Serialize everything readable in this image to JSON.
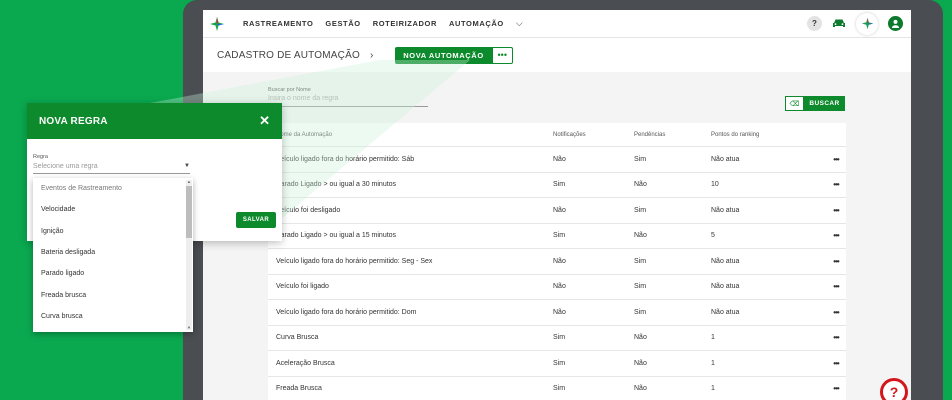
{
  "topbar": {
    "nav": [
      "RASTREAMENTO",
      "GESTÃO",
      "ROTEIRIZADOR",
      "AUTOMAÇÃO"
    ],
    "help_label": "?",
    "user_label": "●"
  },
  "titlebar": {
    "title": "CADASTRO DE AUTOMAÇÃO",
    "chevron": "›",
    "new_button": "NOVA AUTOMAÇÃO",
    "more_button": "•••"
  },
  "search": {
    "label": "Buscar por Nome",
    "placeholder": "Insira o nome da regra",
    "button": "BUSCAR"
  },
  "table": {
    "headers": [
      "Nome da Automação",
      "Notificações",
      "Pendências",
      "Pontos do ranking"
    ],
    "rows": [
      [
        "Veículo ligado fora do horário permitido: Sáb",
        "Não",
        "Sim",
        "Não atua"
      ],
      [
        "Parado Ligado > ou igual a 30 minutos",
        "Sim",
        "Não",
        "10"
      ],
      [
        "Veículo foi desligado",
        "Não",
        "Sim",
        "Não atua"
      ],
      [
        "Parado Ligado > ou igual a 15 minutos",
        "Sim",
        "Não",
        "5"
      ],
      [
        "Veículo ligado fora do horário permitido: Seg - Sex",
        "Não",
        "Sim",
        "Não atua"
      ],
      [
        "Veículo foi ligado",
        "Não",
        "Sim",
        "Não atua"
      ],
      [
        "Veículo ligado fora do horário permitido: Dom",
        "Não",
        "Sim",
        "Não atua"
      ],
      [
        "Curva Brusca",
        "Sim",
        "Não",
        "1"
      ],
      [
        "Aceleração Brusca",
        "Sim",
        "Não",
        "1"
      ],
      [
        "Freada Brusca",
        "Sim",
        "Não",
        "1"
      ]
    ],
    "row_action": "•••"
  },
  "help_float": "?",
  "modal": {
    "title": "NOVA REGRA",
    "close": "✕",
    "field_label": "Regra",
    "field_placeholder": "Selecione uma regra",
    "save_button": "SALVAR"
  },
  "dropdown": {
    "items": [
      "Eventos de Rastreamento",
      "Velocidade",
      "Ignição",
      "Bateria desligada",
      "Parado ligado",
      "Freada brusca",
      "Curva brusca"
    ]
  },
  "colors": {
    "background": "#0aa84f",
    "primary": "#0d8a2c",
    "help_red": "#d4161c"
  }
}
